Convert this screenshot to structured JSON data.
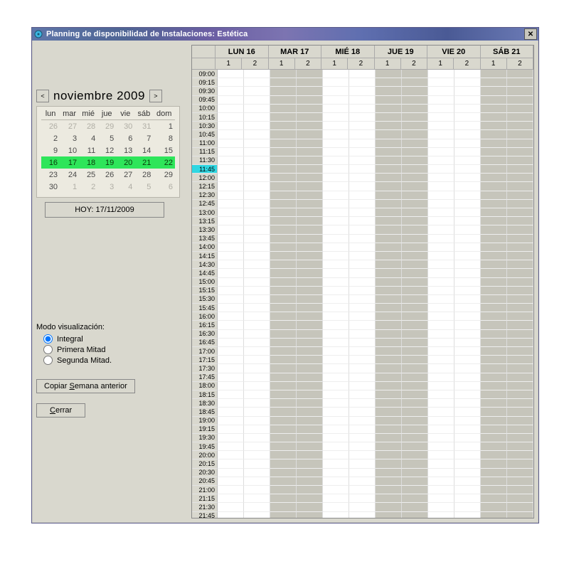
{
  "window": {
    "title": "Planning de disponibilidad de Instalaciones: Estética"
  },
  "monthnav": {
    "label": "noviembre 2009",
    "prev": "<",
    "next": ">"
  },
  "calendar": {
    "dow": [
      "lun",
      "mar",
      "mié",
      "jue",
      "vie",
      "sáb",
      "dom"
    ],
    "rows": [
      {
        "cells": [
          "26",
          "27",
          "28",
          "29",
          "30",
          "31",
          "1"
        ],
        "dim": [
          1,
          1,
          1,
          1,
          1,
          1,
          0
        ]
      },
      {
        "cells": [
          "2",
          "3",
          "4",
          "5",
          "6",
          "7",
          "8"
        ],
        "dim": [
          0,
          0,
          0,
          0,
          0,
          0,
          0
        ]
      },
      {
        "cells": [
          "9",
          "10",
          "11",
          "12",
          "13",
          "14",
          "15"
        ],
        "dim": [
          0,
          0,
          0,
          0,
          0,
          0,
          0
        ]
      },
      {
        "cells": [
          "16",
          "17",
          "18",
          "19",
          "20",
          "21",
          "22"
        ],
        "dim": [
          0,
          0,
          0,
          0,
          0,
          0,
          0
        ],
        "hl": true
      },
      {
        "cells": [
          "23",
          "24",
          "25",
          "26",
          "27",
          "28",
          "29"
        ],
        "dim": [
          0,
          0,
          0,
          0,
          0,
          0,
          0
        ]
      },
      {
        "cells": [
          "30",
          "1",
          "2",
          "3",
          "4",
          "5",
          "6"
        ],
        "dim": [
          0,
          1,
          1,
          1,
          1,
          1,
          1
        ]
      }
    ]
  },
  "today_button": "HOY: 17/11/2009",
  "modo": {
    "label": "Modo visualización:",
    "options": [
      "Integral",
      "Primera Mitad",
      "Segunda Mitad."
    ],
    "selected": 0
  },
  "buttons": {
    "copy_prev_html": "Copiar <span class='ul'>S</span>emana anterior",
    "close_html": "<span class='ul'>C</span>errar"
  },
  "grid": {
    "days": [
      "LUN 16",
      "MAR 17",
      "MIÉ 18",
      "JUE 19",
      "VIE 20",
      "SÁB 21"
    ],
    "sub": [
      "1",
      "2"
    ],
    "times": [
      "09:00",
      "09:15",
      "09:30",
      "09:45",
      "10:00",
      "10:15",
      "10:30",
      "10:45",
      "11:00",
      "11:15",
      "11:30",
      "11:45",
      "12:00",
      "12:15",
      "12:30",
      "12:45",
      "13:00",
      "13:15",
      "13:30",
      "13:45",
      "14:00",
      "14:15",
      "14:30",
      "14:45",
      "15:00",
      "15:15",
      "15:30",
      "15:45",
      "16:00",
      "16:15",
      "16:30",
      "16:45",
      "17:00",
      "17:15",
      "17:30",
      "17:45",
      "18:00",
      "18:15",
      "18:30",
      "18:45",
      "19:00",
      "19:15",
      "19:30",
      "19:45",
      "20:00",
      "20:15",
      "20:30",
      "20:45",
      "21:00",
      "21:15",
      "21:30",
      "21:45"
    ],
    "selected_time": "11:45",
    "shaded_cols": [
      2,
      3,
      6,
      7,
      10,
      11
    ]
  }
}
